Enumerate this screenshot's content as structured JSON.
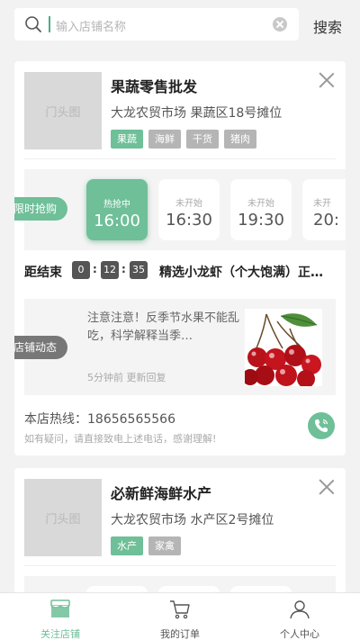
{
  "search": {
    "placeholder": "输入店铺名称",
    "button_label": "搜索"
  },
  "colors": {
    "accent": "#6fbf98",
    "tag_default": "#b5b5b5",
    "news_label": "#777777"
  },
  "shops": [
    {
      "thumb_placeholder": "门头图",
      "name": "果蔬零售批发",
      "address": "大龙农贸市场 果蔬区18号摊位",
      "tags": [
        {
          "label": "果蔬",
          "active": true
        },
        {
          "label": "海鲜",
          "active": false
        },
        {
          "label": "干货",
          "active": false
        },
        {
          "label": "猪肉",
          "active": false
        }
      ],
      "flash_sale": {
        "label": "限时抢购",
        "slots": [
          {
            "status": "热抢中",
            "time": "16:00",
            "active": true
          },
          {
            "status": "未开始",
            "time": "16:30",
            "active": false
          },
          {
            "status": "未开始",
            "time": "19:30",
            "active": false
          },
          {
            "status": "未开",
            "time": "20:",
            "active": false
          }
        ]
      },
      "countdown": {
        "label": "距结束",
        "hours": "0",
        "minutes": "12",
        "seconds": "35",
        "item": "精选小龙虾（个大饱满）正…"
      },
      "news": {
        "label": "店铺动态",
        "text": "注意注意！反季节水果不能乱吃，科学解释当季…",
        "time": "5分钟前 更新回复",
        "image_icon": "cherries-image"
      },
      "hotline": {
        "text": "本店热线：18656565566",
        "tip": "如有疑问，请直接致电上述电话，感谢理解!"
      }
    },
    {
      "thumb_placeholder": "门头图",
      "name": "必新鲜海鲜水产",
      "address": "大龙农贸市场 水产区2号摊位",
      "tags": [
        {
          "label": "水产",
          "active": true
        },
        {
          "label": "家禽",
          "active": false
        }
      ]
    }
  ],
  "tabbar": {
    "items": [
      {
        "label": "关注店铺",
        "icon": "shop-icon",
        "active": true
      },
      {
        "label": "我的订单",
        "icon": "cart-icon",
        "active": false
      },
      {
        "label": "个人中心",
        "icon": "user-icon",
        "active": false
      }
    ]
  }
}
